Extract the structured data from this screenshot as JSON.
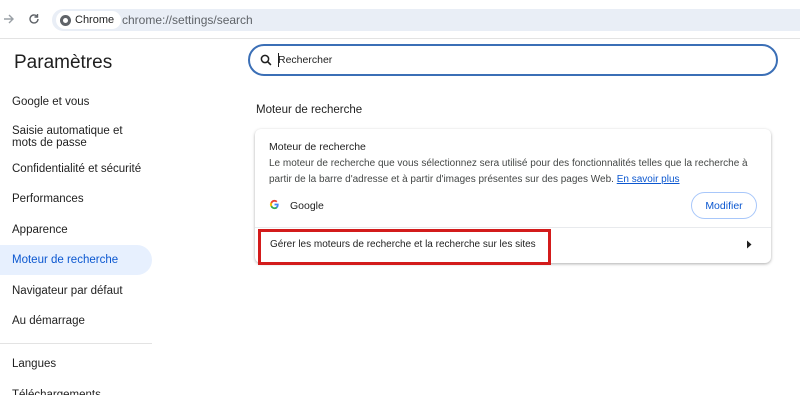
{
  "browser": {
    "chip_label": "Chrome",
    "url": "chrome://settings/search"
  },
  "sidebar": {
    "title": "Paramètres",
    "items": [
      {
        "label": "Google et vous"
      },
      {
        "label": "Saisie automatique et mots de passe"
      },
      {
        "label": "Confidentialité et sécurité"
      },
      {
        "label": "Performances"
      },
      {
        "label": "Apparence"
      },
      {
        "label": "Moteur de recherche"
      },
      {
        "label": "Navigateur par défaut"
      },
      {
        "label": "Au démarrage"
      },
      {
        "label": "Langues"
      },
      {
        "label": "Téléchargements"
      }
    ]
  },
  "search": {
    "placeholder": "Rechercher"
  },
  "section": {
    "title": "Moteur de recherche",
    "card": {
      "heading": "Moteur de recherche",
      "description": "Le moteur de recherche que vous sélectionnez sera utilisé pour des fonctionnalités telles que la recherche à partir de la barre d'adresse et à partir d'images présentes sur des pages Web.",
      "link": "En savoir plus",
      "engine_name": "Google",
      "modify_label": "Modifier",
      "manage_label": "Gérer les moteurs de recherche et la recherche sur les sites"
    }
  },
  "colors": {
    "accent": "#0b57d0",
    "highlight": "#d31b1b",
    "active_bg": "#e7f0fe"
  }
}
